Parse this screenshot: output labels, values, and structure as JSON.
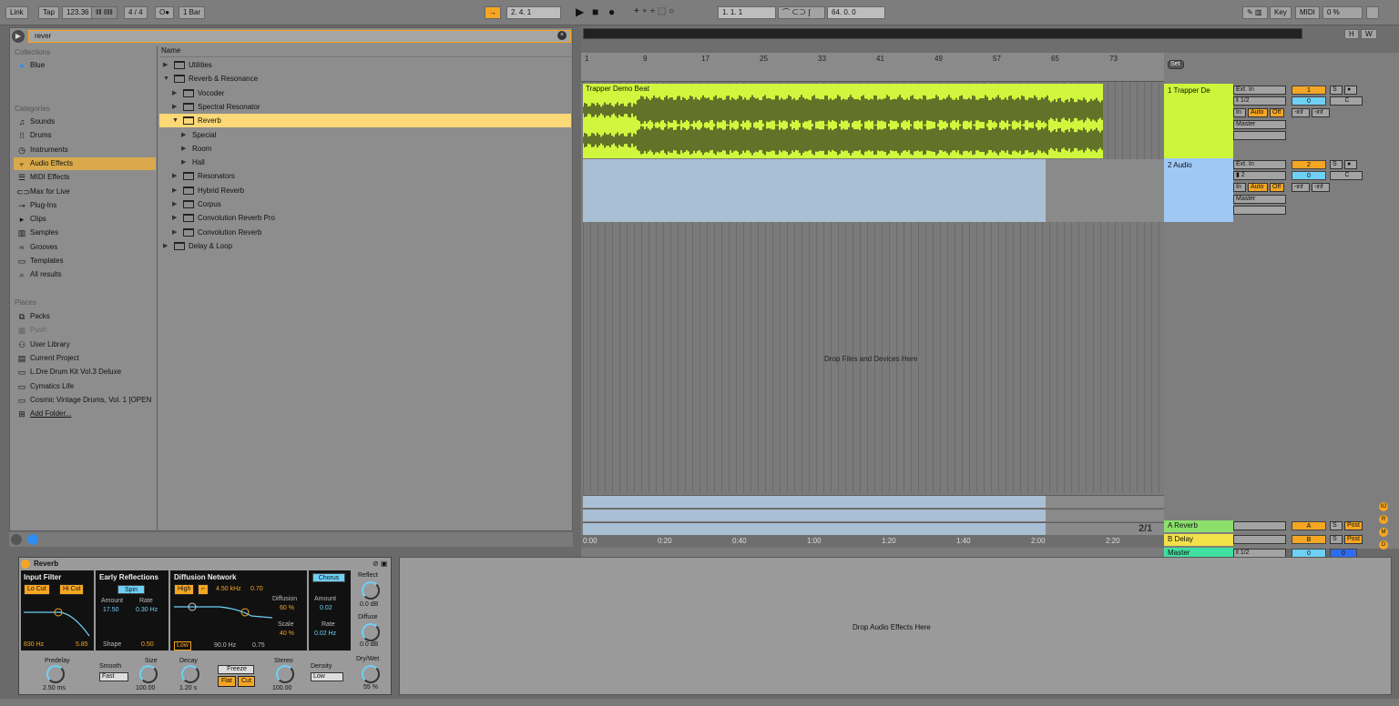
{
  "transport": {
    "link": "Link",
    "tap": "Tap",
    "tempo": "123.36",
    "sig": "4 / 4",
    "rec_mode": "O●",
    "quant": "1 Bar",
    "pos": "2.   4.   1",
    "loop_start": "1.   1.   1",
    "loop_len": "64.   0.   0",
    "key": "Key",
    "midi": "MIDI",
    "cpu": "0 %"
  },
  "browser": {
    "search_value": "rever",
    "collections_head": "Collections",
    "collection_blue": "Blue",
    "categories_head": "Categories",
    "categories": [
      {
        "label": "Sounds",
        "icon": "♫"
      },
      {
        "label": "Drums",
        "icon": "⁞⁞"
      },
      {
        "label": "Instruments",
        "icon": "◷"
      },
      {
        "label": "Audio Effects",
        "icon": "⫟"
      },
      {
        "label": "MIDI Effects",
        "icon": "☰"
      },
      {
        "label": "Max for Live",
        "icon": "⊂⊃"
      },
      {
        "label": "Plug-Ins",
        "icon": "⊸"
      },
      {
        "label": "Clips",
        "icon": "▸"
      },
      {
        "label": "Samples",
        "icon": "▥"
      },
      {
        "label": "Grooves",
        "icon": "≈"
      },
      {
        "label": "Templates",
        "icon": "▭"
      },
      {
        "label": "All results",
        "icon": "⌕"
      }
    ],
    "places_head": "Places",
    "places": [
      {
        "label": "Packs",
        "icon": "⧉"
      },
      {
        "label": "Push",
        "icon": "▦"
      },
      {
        "label": "User Library",
        "icon": "⚇"
      },
      {
        "label": "Current Project",
        "icon": "▤"
      },
      {
        "label": "L.Dre Drum Kit Vol.3 Deluxe",
        "icon": "▭"
      },
      {
        "label": "Cymatics Life",
        "icon": "▭"
      },
      {
        "label": "Cosmic Vintage Drums, Vol. 1 [OPEN",
        "icon": "▭"
      },
      {
        "label": "Add Folder...",
        "icon": "⊞"
      }
    ],
    "name_head": "Name",
    "files": [
      {
        "label": "Utilities",
        "tri": "▶",
        "depth": 0,
        "folder": true
      },
      {
        "label": "Reverb & Resonance",
        "tri": "▼",
        "depth": 0,
        "folder": true
      },
      {
        "label": "Vocoder",
        "tri": "▶",
        "depth": 1,
        "folder": true
      },
      {
        "label": "Spectral Resonator",
        "tri": "▶",
        "depth": 1,
        "folder": true
      },
      {
        "label": "Reverb",
        "tri": "▼",
        "depth": 1,
        "folder": true
      },
      {
        "label": "Special",
        "tri": "▶",
        "depth": 2,
        "folder": false
      },
      {
        "label": "Room",
        "tri": "▶",
        "depth": 2,
        "folder": false
      },
      {
        "label": "Hall",
        "tri": "▶",
        "depth": 2,
        "folder": false
      },
      {
        "label": "Resonators",
        "tri": "▶",
        "depth": 1,
        "folder": true
      },
      {
        "label": "Hybrid Reverb",
        "tri": "▶",
        "depth": 1,
        "folder": true
      },
      {
        "label": "Corpus",
        "tri": "▶",
        "depth": 1,
        "folder": true
      },
      {
        "label": "Convolution Reverb Pro",
        "tri": "▶",
        "depth": 1,
        "folder": true
      },
      {
        "label": "Convolution Reverb",
        "tri": "▶",
        "depth": 1,
        "folder": true
      },
      {
        "label": "Delay & Loop",
        "tri": "▶",
        "depth": 0,
        "folder": true
      }
    ]
  },
  "arrangement": {
    "bars": [
      "1",
      "9",
      "17",
      "25",
      "33",
      "41",
      "49",
      "57",
      "65",
      "73"
    ],
    "clip1_title": "Trapper Demo Beat",
    "drop_text": "Drop Files and Devices Here",
    "times": [
      "0:00",
      "0:20",
      "0:40",
      "1:00",
      "1:20",
      "1:40",
      "2:00",
      "2:20"
    ],
    "page": "2/1",
    "set": "Set",
    "hw_h": "H",
    "hw_w": "W"
  },
  "tracks": [
    {
      "name": "1 Trapper De",
      "input": "Ext. In",
      "chan": "‖ 1/2",
      "mon_in": "In",
      "mon_auto": "Auto",
      "mon_off": "Off",
      "out": "Master",
      "num": "1",
      "vol": "0",
      "pan": "C",
      "s": "S",
      "peak1": "-inf",
      "peak2": "-inf",
      "color": "#cdf53b"
    },
    {
      "name": "2 Audio",
      "input": "Ext. In",
      "chan": "▮ 2",
      "mon_in": "In",
      "mon_auto": "Auto",
      "mon_off": "Off",
      "out": "Master",
      "num": "2",
      "vol": "0",
      "pan": "C",
      "s": "S",
      "peak1": "-inf",
      "peak2": "-inf",
      "color": "#9fc8f5"
    }
  ],
  "returns": [
    {
      "name": "A Reverb",
      "num": "A",
      "s": "S",
      "post": "Post",
      "color": "#8be06b"
    },
    {
      "name": "B Delay",
      "num": "B",
      "s": "S",
      "post": "Post",
      "color": "#f3e14a"
    },
    {
      "name": "Master",
      "num": "‖ 1/2",
      "vol": "0",
      "vol2": "0",
      "color": "#3fe0a0"
    }
  ],
  "device": {
    "title": "Reverb",
    "input_filter": "Input Filter",
    "lo_cut": "Lo Cut",
    "hi_cut": "Hi Cut",
    "freq": "830 Hz",
    "q": "5.85",
    "early": "Early Reflections",
    "spin": "Spin",
    "amount_l": "Amount",
    "rate_l": "Rate",
    "amount": "17.50",
    "rate": "0.30 Hz",
    "shape_l": "Shape",
    "shape": "0.50",
    "diffusion_net": "Diffusion Network",
    "high": "High",
    "high_freq": "4.50 kHz",
    "high_val": "0.70",
    "low": "Low",
    "low_freq": "90.0 Hz",
    "low_val": "0.75",
    "diffusion_l": "Diffusion",
    "diffusion": "60 %",
    "scale_l": "Scale",
    "scale": "40 %",
    "chorus": "Chorus",
    "ch_amount_l": "Amount",
    "ch_amount": "0.02",
    "ch_rate_l": "Rate",
    "ch_rate": "0.02 Hz",
    "reflect_l": "Reflect",
    "reflect": "0.0 dB",
    "diffuse_l": "Diffuse",
    "diffuse": "0.0 dB",
    "predelay_l": "Predelay",
    "predelay": "2.50 ms",
    "smooth_l": "Smooth",
    "smooth": "Fast",
    "size_l": "Size",
    "size": "100.00",
    "decay_l": "Decay",
    "decay": "1.20 s",
    "freeze": "Freeze",
    "flat": "Flat",
    "cut": "Cut",
    "stereo_l": "Stereo",
    "stereo": "100.00",
    "density_l": "Density",
    "density": "Low",
    "drywet_l": "Dry/Wet",
    "drywet": "55 %"
  },
  "device_drop": "Drop Audio Effects Here",
  "side_dots": [
    "IO",
    "R",
    "M",
    "D"
  ]
}
